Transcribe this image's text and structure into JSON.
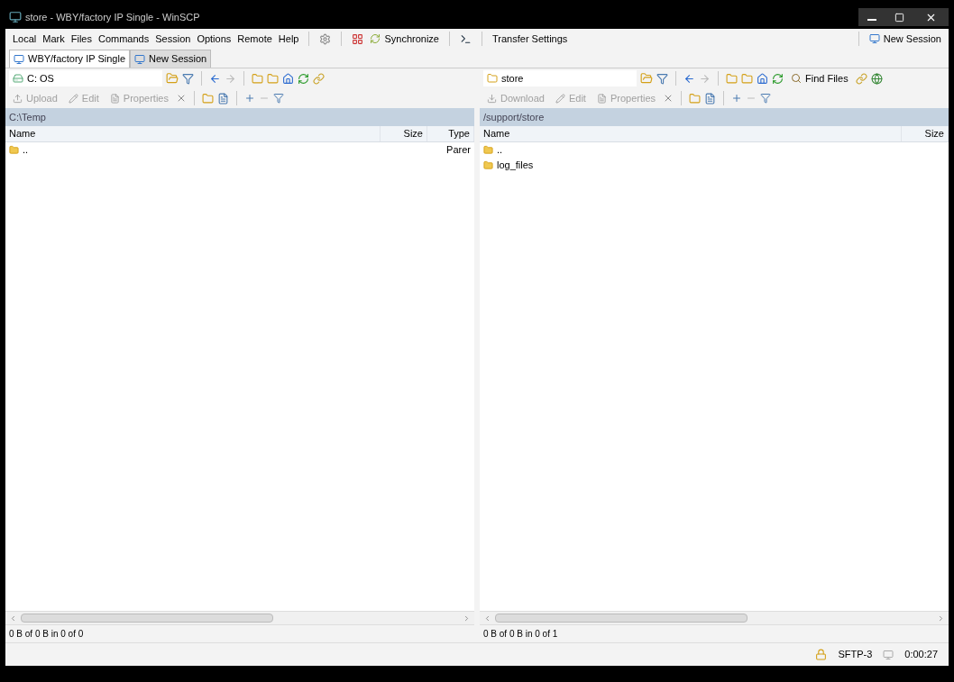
{
  "window": {
    "title": "store - WBY/factory IP Single - WinSCP"
  },
  "menu": [
    "Local",
    "Mark",
    "Files",
    "Commands",
    "Session",
    "Options",
    "Remote",
    "Help"
  ],
  "toolbar": {
    "synchronize": "Synchronize",
    "transfer_settings": "Transfer Settings",
    "new_session": "New Session"
  },
  "tabs": [
    {
      "label": "WBY/factory IP Single",
      "selected": true
    },
    {
      "label": "New Session",
      "selected": false
    }
  ],
  "panels": [
    {
      "kind": "local",
      "location": "C: OS",
      "actions": [
        {
          "label": "Upload",
          "disabled": true
        },
        {
          "label": "Edit",
          "disabled": true
        },
        {
          "label": "Properties",
          "disabled": true
        }
      ],
      "path": "C:\\Temp",
      "columns": [
        "Name",
        "Size",
        "Type"
      ],
      "rows": [
        {
          "cells": [
            "..",
            "",
            "Parer"
          ]
        }
      ],
      "status": "0 B of 0 B in 0 of 0"
    },
    {
      "kind": "remote",
      "location": "store",
      "actions": [
        {
          "label": "Download",
          "disabled": true
        },
        {
          "label": "Edit",
          "disabled": true
        },
        {
          "label": "Properties",
          "disabled": true
        }
      ],
      "find_files": "Find Files",
      "path": "/support/store",
      "columns": [
        "Name",
        "Size"
      ],
      "rows": [
        {
          "cells": [
            "..",
            ""
          ]
        },
        {
          "cells": [
            "log_files",
            ""
          ]
        }
      ],
      "status": "0 B of 0 B in 0 of 1"
    }
  ],
  "status_bar": {
    "protocol": "SFTP-3",
    "time": "0:00:27"
  }
}
